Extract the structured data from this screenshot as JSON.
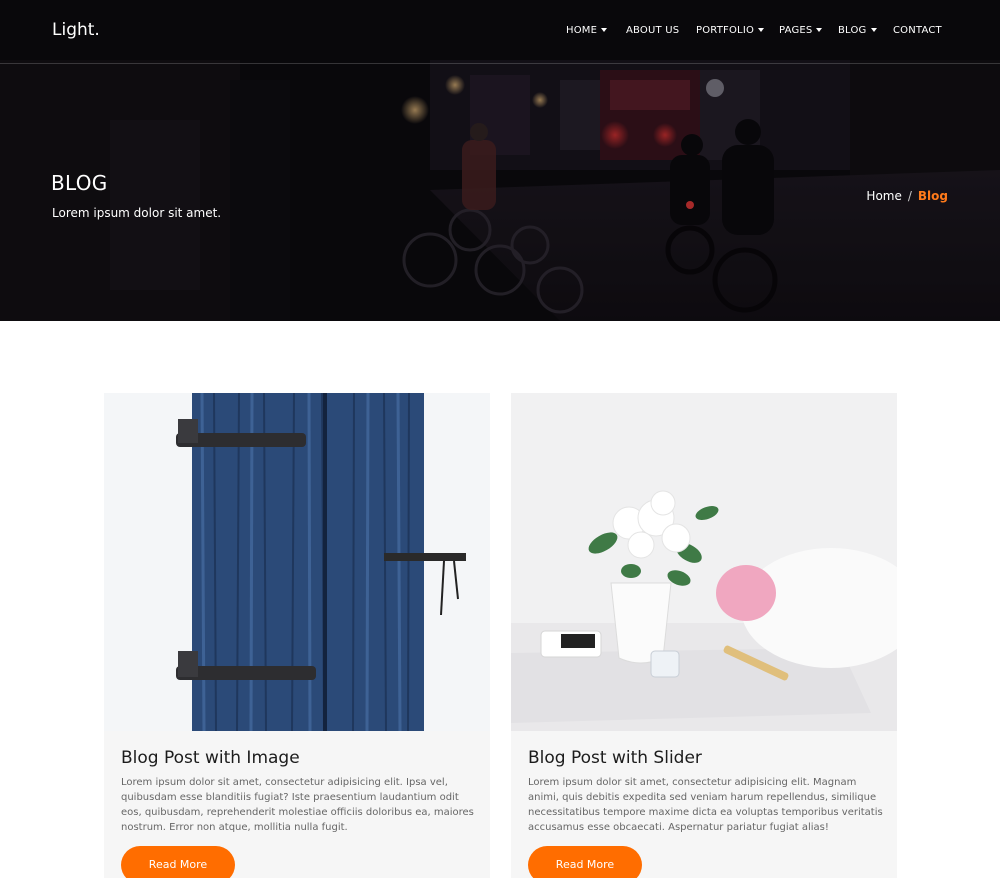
{
  "brand": "Light.",
  "nav": {
    "items": [
      {
        "label": "HOME",
        "dropdown": true
      },
      {
        "label": "ABOUT US",
        "dropdown": false
      },
      {
        "label": "PORTFOLIO",
        "dropdown": true
      },
      {
        "label": "PAGES",
        "dropdown": true
      },
      {
        "label": "BLOG",
        "dropdown": true
      },
      {
        "label": "CONTACT",
        "dropdown": false
      }
    ]
  },
  "hero": {
    "title": "BLOG",
    "subtitle": "Lorem ipsum dolor sit amet.",
    "breadcrumb": {
      "home": "Home",
      "separator": "/",
      "current": "Blog"
    }
  },
  "posts": [
    {
      "title": "Blog Post with Image",
      "excerpt": "Lorem ipsum dolor sit amet, consectetur adipisicing elit. Ipsa vel, quibusdam esse blanditiis fugiat? Iste praesentium laudantium odit eos, quibusdam, reprehenderit molestiae officiis doloribus ea, maiores nostrum. Error non atque, mollitia nulla fugit.",
      "button": "Read More"
    },
    {
      "title": "Blog Post with Slider",
      "excerpt": "Lorem ipsum dolor sit amet, consectetur adipisicing elit. Magnam animi, quis debitis expedita sed veniam harum repellendus, similique necessitatibus tempore maxime dicta ea voluptas temporibus veritatis accusamus esse obcaecati. Aspernatur pariatur fugiat alias!",
      "button": "Read More"
    }
  ],
  "colors": {
    "accent": "#ff6d00",
    "breadcrumb_active": "#ff7a1a",
    "card_bg": "#f6f6f6"
  },
  "icons": {
    "dropdown": "caret-down-icon"
  }
}
